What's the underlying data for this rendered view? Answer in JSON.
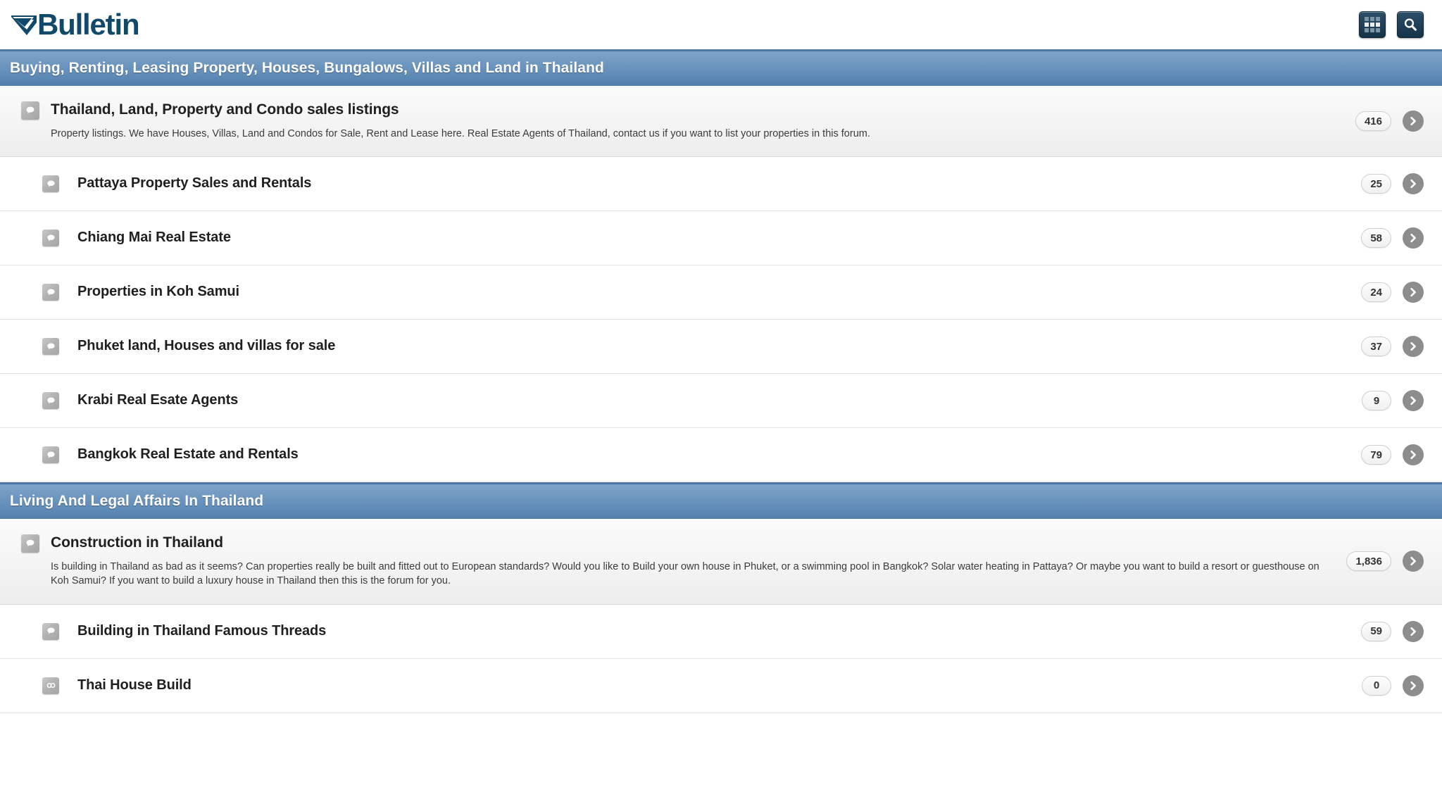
{
  "site": {
    "logo_text": "Bulletin",
    "logo_mark": "v-check-logo"
  },
  "topbar": {
    "grid_button_label": "grid-menu-icon",
    "search_button_label": "search-icon"
  },
  "sections": [
    {
      "title": "Buying, Renting, Leasing Property, Houses, Bungalows, Villas and Land in Thailand",
      "forums": [
        {
          "title": "Thailand, Land, Property and Condo sales listings",
          "description": "Property listings. We have Houses, Villas, Land and Condos for Sale, Rent and Lease here. Real Estate Agents of Thailand, contact us if you want to list your properties in this forum.",
          "count": "416",
          "level": "parent",
          "icon": "speech-bubble-icon"
        },
        {
          "title": "Pattaya Property Sales and Rentals",
          "description": "",
          "count": "25",
          "level": "sub",
          "icon": "speech-bubble-icon"
        },
        {
          "title": "Chiang Mai Real Estate",
          "description": "",
          "count": "58",
          "level": "sub",
          "icon": "speech-bubble-icon"
        },
        {
          "title": "Properties in Koh Samui",
          "description": "",
          "count": "24",
          "level": "sub",
          "icon": "speech-bubble-icon"
        },
        {
          "title": "Phuket land, Houses and villas for sale",
          "description": "",
          "count": "37",
          "level": "sub",
          "icon": "speech-bubble-icon"
        },
        {
          "title": "Krabi Real Esate Agents",
          "description": "",
          "count": "9",
          "level": "sub",
          "icon": "speech-bubble-icon"
        },
        {
          "title": "Bangkok Real Estate and Rentals",
          "description": "",
          "count": "79",
          "level": "sub",
          "icon": "speech-bubble-icon"
        }
      ]
    },
    {
      "title": "Living And Legal Affairs In Thailand",
      "forums": [
        {
          "title": "Construction in Thailand",
          "description": "Is building in Thailand as bad as it seems? Can properties really be built and fitted out to European standards? Would you like to Build your own house in Phuket, or a swimming pool in Bangkok? Solar water heating in Pattaya? Or maybe you want to build a resort or guesthouse on Koh Samui? If you want to build a luxury house in Thailand then this is the forum for you.",
          "count": "1,836",
          "level": "parent",
          "icon": "speech-bubble-icon"
        },
        {
          "title": "Building in Thailand Famous Threads",
          "description": "",
          "count": "59",
          "level": "sub",
          "icon": "speech-bubble-icon"
        },
        {
          "title": "Thai House Build",
          "description": "",
          "count": "0",
          "level": "sub",
          "icon": "link-chain-icon"
        }
      ]
    }
  ],
  "colors": {
    "section_header_blue": "#5d89b6",
    "logo_navy": "#11496b",
    "icon_button_navy": "#1b3c55",
    "chevron_grey": "#8d8d8d"
  }
}
